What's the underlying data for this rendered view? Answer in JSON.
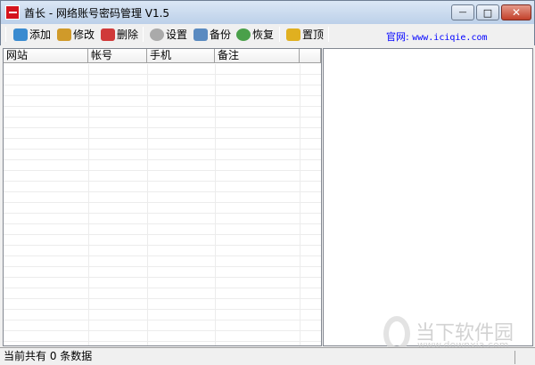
{
  "window": {
    "title": "酋长 - 网络账号密码管理 V1.5",
    "minimize": "—",
    "maximize": "□",
    "close": "✕"
  },
  "toolbar": {
    "items": [
      {
        "label": "添加",
        "icon": "add-user-icon",
        "color": "#3a8bd0"
      },
      {
        "label": "修改",
        "icon": "edit-user-icon",
        "color": "#d09a2a"
      },
      {
        "label": "删除",
        "icon": "delete-user-icon",
        "color": "#d03a3a"
      },
      {
        "label": "设置",
        "icon": "gear-icon",
        "color": "#9a9a9a"
      },
      {
        "label": "备份",
        "icon": "backup-icon",
        "color": "#5a8ac0"
      },
      {
        "label": "恢复",
        "icon": "restore-icon",
        "color": "#4aa04a"
      },
      {
        "label": "置顶",
        "icon": "pin-top-icon",
        "color": "#e0b020"
      }
    ],
    "site_label": "官网:",
    "site_url": "www.iciqie.com"
  },
  "list": {
    "columns": [
      "网站",
      "帐号",
      "手机",
      "备注"
    ],
    "rows": []
  },
  "status": {
    "text": "当前共有 0 条数据"
  },
  "watermark": {
    "name": "当下软件园",
    "url": "www.downxia.com"
  }
}
